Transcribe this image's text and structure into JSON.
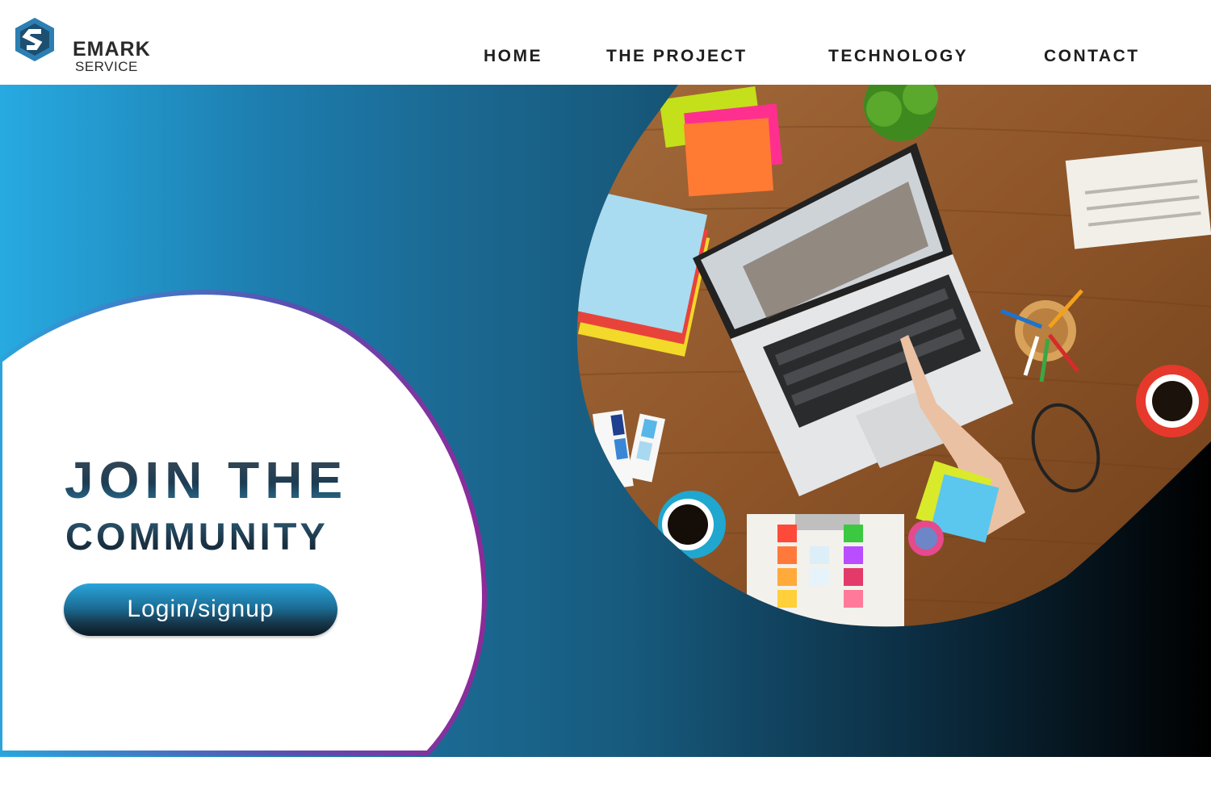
{
  "brand": {
    "name": "EMARK",
    "tagline": "SERVICE"
  },
  "nav": {
    "items": [
      "HOME",
      "THE PROJECT",
      "TECHNOLOGY",
      "CONTACT"
    ]
  },
  "hero": {
    "title_line1": "JOIN THE",
    "title_line2": "COMMUNITY",
    "cta_label": "Login/signup",
    "photo_subject": "overhead-desk-laptop-photo"
  },
  "colors": {
    "gradient_start": "#27aae1",
    "gradient_mid": "#1b6891",
    "gradient_end": "#000000",
    "arc_border_start": "#2aa4da",
    "arc_border_end": "#8e2a9a",
    "nav_text": "#1e1e1e"
  }
}
